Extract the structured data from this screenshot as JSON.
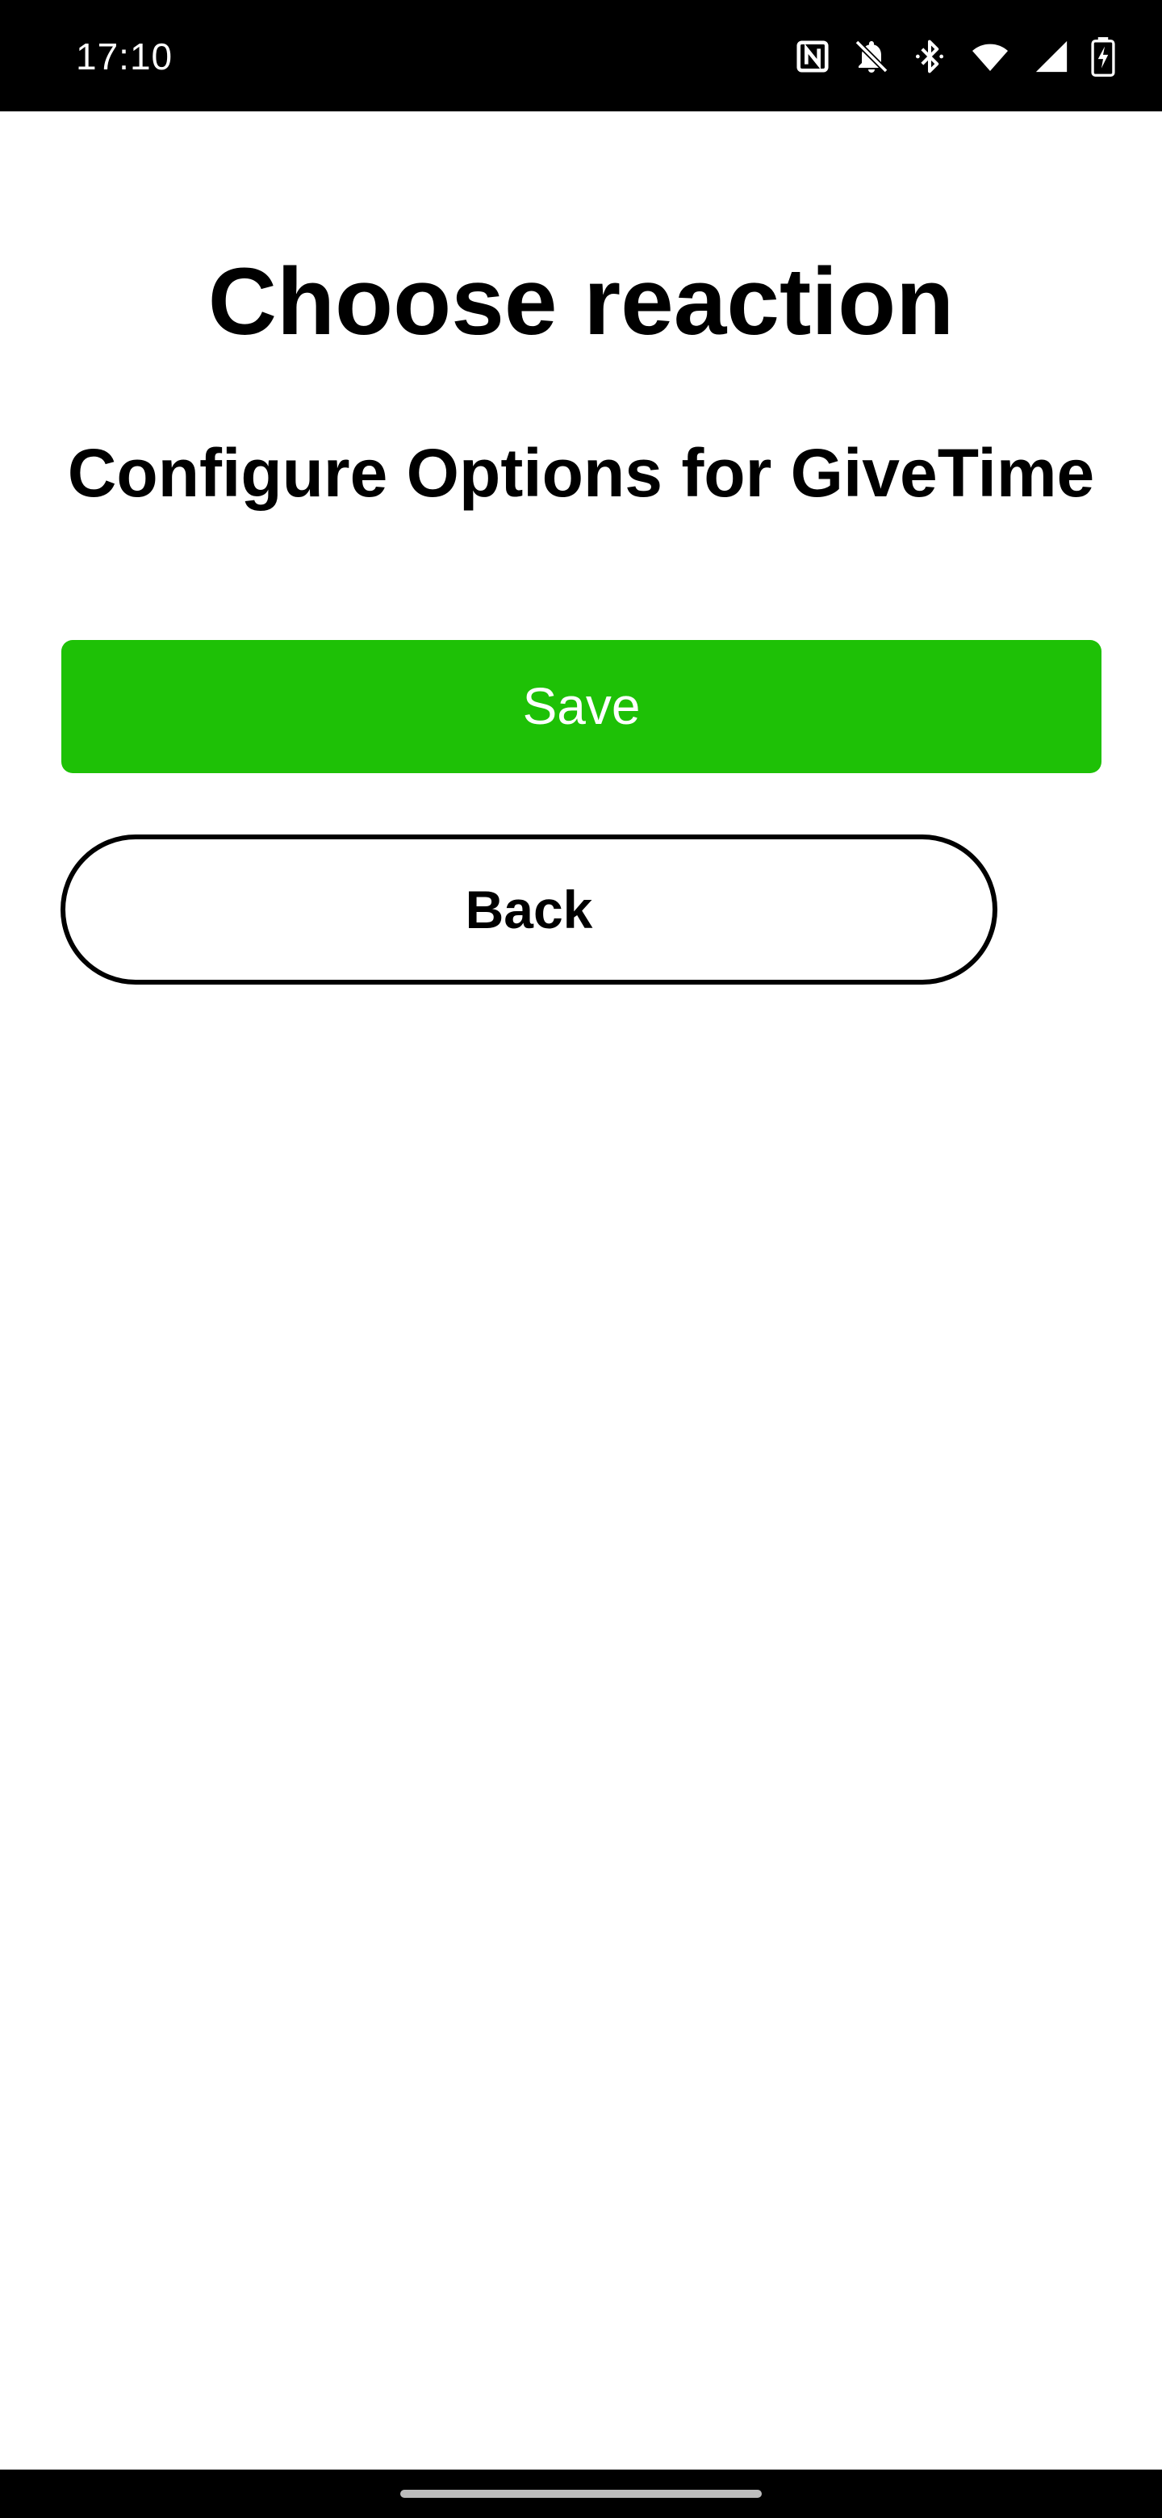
{
  "status_bar": {
    "time": "17:10",
    "icons": [
      "nfc-icon",
      "notifications-off-icon",
      "bluetooth-icon",
      "wifi-icon",
      "cell-signal-icon",
      "battery-charging-icon"
    ]
  },
  "page": {
    "title": "Choose reaction",
    "subtitle": "Configure Options for GiveTime"
  },
  "actions": {
    "save_label": "Save",
    "back_label": "Back"
  },
  "colors": {
    "save_button": "#1ec106",
    "background": "#ffffff",
    "status_bar": "#000000"
  }
}
